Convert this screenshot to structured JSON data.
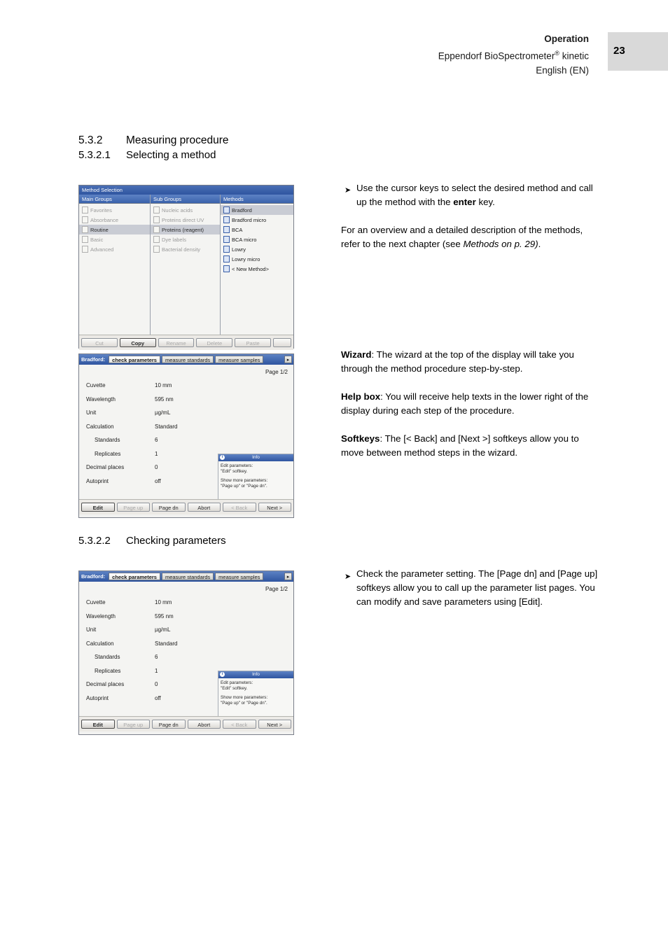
{
  "header": {
    "line1": "Operation",
    "line2_pre": "Eppendorf BioSpectrometer",
    "line2_sup": "®",
    "line2_post": " kinetic",
    "line3": "English (EN)",
    "page_number": "23"
  },
  "sections": {
    "s532_num": "5.3.2",
    "s532_title": "Measuring procedure",
    "s5321_num": "5.3.2.1",
    "s5321_title": "Selecting a method",
    "s5322_num": "5.3.2.2",
    "s5322_title": "Checking parameters"
  },
  "text_blocks": {
    "b1_arrow": "➤",
    "b1_p1": "Use the cursor keys to select the desired method and call up the method with the ",
    "b1_p1_bold": "enter",
    "b1_p1_cont": " key.",
    "b1_p2_pre": "For an overview and a detailed description of the methods, refer to the next chapter (see ",
    "b1_p2_italic": "Methods on p. 29)",
    "b1_p2_post": ".",
    "b2_wizard_label": "Wizard",
    "b2_wizard_text": ": The wizard at the top of the display will take you through the method procedure step-by-step.",
    "b2_help_label": "Help box",
    "b2_help_text": ": You will receive help texts in the lower right of the display during each step of the procedure.",
    "b2_soft_label": "Softkeys",
    "b2_soft_text": ": The [< Back] and [Next >] softkeys allow you to move between method steps in the wizard.",
    "b3_arrow": "➤",
    "b3_text": "Check the parameter setting. The [Page dn] and [Page up] softkeys allow you to call up the parameter list pages. You can modify and save parameters using [Edit]."
  },
  "method_selection": {
    "title": "Method Selection",
    "columns": [
      {
        "header": "Main Groups",
        "items": [
          {
            "label": "Favorites",
            "icon": "folder-icon",
            "state": "normal"
          },
          {
            "label": "Absorbance",
            "icon": "folder-icon",
            "state": "normal"
          },
          {
            "label": "Routine",
            "icon": "folder-icon",
            "state": "selected"
          },
          {
            "label": "Basic",
            "icon": "folder-icon",
            "state": "normal"
          },
          {
            "label": "Advanced",
            "icon": "folder-icon",
            "state": "normal"
          }
        ]
      },
      {
        "header": "Sub Groups",
        "items": [
          {
            "label": "Nucleic acids",
            "icon": "folder-icon",
            "state": "normal"
          },
          {
            "label": "Proteins direct UV",
            "icon": "folder-icon",
            "state": "normal"
          },
          {
            "label": "Proteins (reagent)",
            "icon": "folder-icon",
            "state": "selected"
          },
          {
            "label": "Dye labels",
            "icon": "folder-icon",
            "state": "normal"
          },
          {
            "label": "Bacterial density",
            "icon": "folder-icon",
            "state": "normal"
          }
        ]
      },
      {
        "header": "Methods",
        "items": [
          {
            "label": "Bradford",
            "icon": "document-icon",
            "state": "selected"
          },
          {
            "label": "Bradford micro",
            "icon": "document-icon",
            "state": "normal"
          },
          {
            "label": "BCA",
            "icon": "document-icon",
            "state": "normal"
          },
          {
            "label": "BCA micro",
            "icon": "document-icon",
            "state": "normal"
          },
          {
            "label": "Lowry",
            "icon": "document-icon",
            "state": "normal"
          },
          {
            "label": "Lowry micro",
            "icon": "document-icon",
            "state": "normal"
          },
          {
            "label": "< New Method>",
            "icon": "document-icon",
            "state": "normal"
          }
        ]
      }
    ],
    "buttons": [
      {
        "label": "Cut",
        "state": "disabled"
      },
      {
        "label": "Copy",
        "state": "active"
      },
      {
        "label": "Rename",
        "state": "disabled"
      },
      {
        "label": "Delete",
        "state": "disabled"
      },
      {
        "label": "Paste",
        "state": "disabled"
      },
      {
        "label": "",
        "state": "disabled"
      }
    ]
  },
  "wizard": {
    "method": "Bradford:",
    "tabs": [
      {
        "label": "check parameters",
        "active": true
      },
      {
        "label": "measure standards",
        "active": false
      },
      {
        "label": "measure samples",
        "active": false
      }
    ],
    "tab_more_icon": "chevron-right-icon",
    "page_indicator": "Page 1/2",
    "parameters": [
      {
        "name": "Cuvette",
        "value": "10 mm",
        "indent": false
      },
      {
        "name": "Wavelength",
        "value": "595  nm",
        "indent": false
      },
      {
        "name": "Unit",
        "value": "µg/mL",
        "indent": false
      },
      {
        "name": "Calculation",
        "value": "Standard",
        "indent": false
      },
      {
        "name": "Standards",
        "value": "6",
        "indent": true
      },
      {
        "name": "Replicates",
        "value": "1",
        "indent": true
      },
      {
        "name": "Decimal places",
        "value": "0",
        "indent": false
      },
      {
        "name": "Autoprint",
        "value": "off",
        "indent": false
      }
    ],
    "info": {
      "badge": "i",
      "title": "Info",
      "line1": "Edit parameters:",
      "line2": "\"Edit\" softkey.",
      "line3": "Show more parameters:",
      "line4": "\"Page up\" or \"Page dn\"."
    },
    "softkeys": [
      {
        "label": "Edit",
        "state": "active"
      },
      {
        "label": "Page up",
        "state": "disabled"
      },
      {
        "label": "Page dn",
        "state": "active"
      },
      {
        "label": "Abort",
        "state": "active"
      },
      {
        "label": "< Back",
        "state": "disabled"
      },
      {
        "label": "Next >",
        "state": "active"
      }
    ]
  }
}
